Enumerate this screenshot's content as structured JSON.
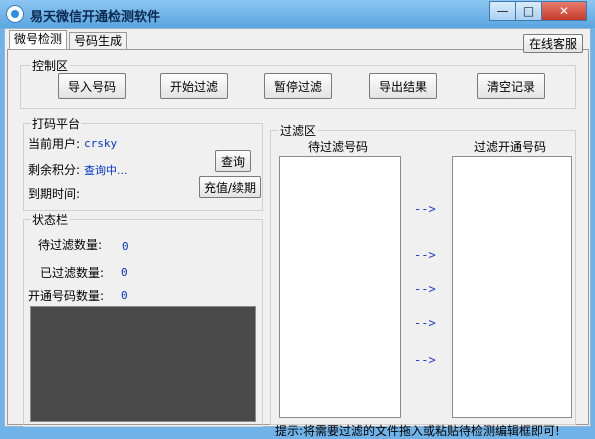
{
  "window": {
    "title": "易天微信开通检测软件",
    "minimize": "—",
    "maximize": "□",
    "close": "✕"
  },
  "tabs": [
    {
      "label": "微号检测"
    },
    {
      "label": "号码生成"
    }
  ],
  "service_button": "在线客服",
  "control": {
    "legend": "控制区",
    "buttons": [
      "导入号码",
      "开始过滤",
      "暂停过滤",
      "导出结果",
      "清空记录"
    ]
  },
  "platform": {
    "legend": "打码平台",
    "user_label": "当前用户:",
    "user_value": "crsky",
    "points_label": "剩余积分:",
    "points_value": "查询中...",
    "expiry_label": "到期时间:",
    "query_button": "查询",
    "recharge_button": "充值/续期"
  },
  "status": {
    "legend": "状态栏",
    "pending_label": "待过滤数量:",
    "pending_value": "0",
    "filtered_label": "已过滤数量:",
    "filtered_value": "0",
    "opened_label": "开通号码数量:",
    "opened_value": "0"
  },
  "filter": {
    "legend": "过滤区",
    "pending_header": "待过滤号码",
    "opened_header": "过滤开通号码",
    "arrows": [
      "-->",
      "-->",
      "-->",
      "-->",
      "-->"
    ]
  },
  "hint": "提示:将需要过滤的文件拖入或粘贴待检测编辑框即可!",
  "colors": {
    "value_blue": "#0033cc",
    "log_bg": "#4a4a4a",
    "title_bar": "#6fb3e8"
  }
}
